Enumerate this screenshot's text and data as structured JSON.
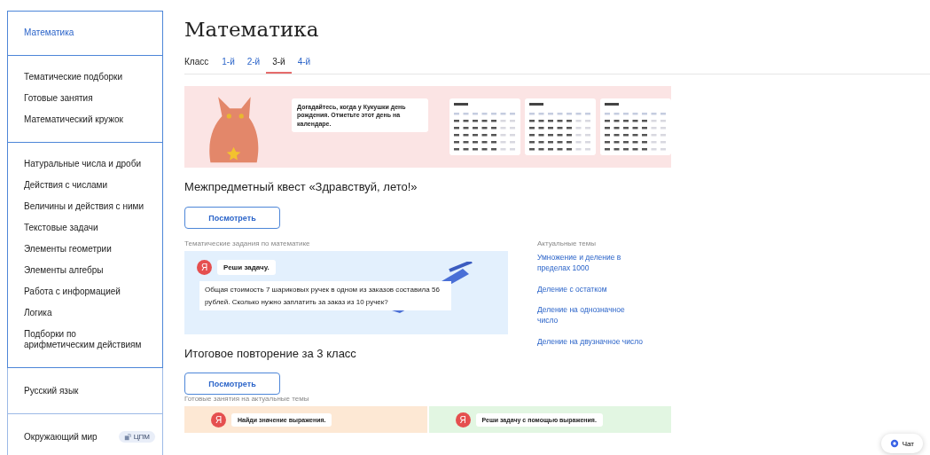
{
  "sidebar": {
    "groups": [
      {
        "items": [
          {
            "label": "Математика",
            "selected": true
          }
        ]
      },
      {
        "items": [
          {
            "label": "Тематические подборки",
            "selected": false
          },
          {
            "label": "Готовые занятия",
            "selected": false
          },
          {
            "label": "Математический кружок",
            "selected": false
          }
        ]
      },
      {
        "items": [
          {
            "label": "Натуральные числа и дроби",
            "selected": false
          },
          {
            "label": "Действия с числами",
            "selected": false
          },
          {
            "label": "Величины и действия с ними",
            "selected": false
          },
          {
            "label": "Текстовые задачи",
            "selected": false
          },
          {
            "label": "Элементы геометрии",
            "selected": false
          },
          {
            "label": "Элементы алгебры",
            "selected": false
          },
          {
            "label": "Работа с информацией",
            "selected": false
          },
          {
            "label": "Логика",
            "selected": false
          },
          {
            "label": "Подборки по арифметическим действиям",
            "selected": false
          }
        ]
      }
    ],
    "subjects": [
      {
        "label": "Русский язык",
        "selected": false
      },
      {
        "label": "Окружающий мир",
        "selected": false,
        "badge": "ЦПМ"
      }
    ]
  },
  "title": "Математика",
  "grade_tabs": {
    "label": "Класс",
    "tabs": [
      {
        "label": "1-й",
        "selected": false
      },
      {
        "label": "2-й",
        "selected": false
      },
      {
        "label": "3-й",
        "selected": true
      },
      {
        "label": "4-й",
        "selected": false
      }
    ]
  },
  "banner": {
    "bubble": "Догадайтесь, когда у Кукушки день рождения. Отметьте этот день на календаре."
  },
  "quest": {
    "title": "Межпредметный квест «Здравствуй, лето!»",
    "button": "Посмотреть"
  },
  "tasks": {
    "caption": "Тематические задания по математике",
    "logo": "Я",
    "prompt": "Реши задачу.",
    "problem": "Общая стоимость 7 шариковых ручек в одном из заказов составила 56 рублей. Сколько нужно заплатить за заказ из 10 ручек?"
  },
  "topics": {
    "caption": "Актуальные темы",
    "links": [
      "Умножение и деление в пределах 1000",
      "Деление с остатком",
      "Деление на однозначное число",
      "Деление на двузначное число"
    ]
  },
  "review": {
    "title": "Итоговое повторение за 3 класс",
    "button": "Посмотреть"
  },
  "lessons": {
    "caption": "Готовые занятия на актуальные темы",
    "cards": [
      {
        "logo": "Я",
        "prompt": "Найди значение выражения.",
        "color": "#fde8d4"
      },
      {
        "logo": "Я",
        "prompt": "Реши задачу с помощью выражения.",
        "color": "#e2f6e2"
      }
    ]
  },
  "chat": {
    "label": "Чат"
  }
}
